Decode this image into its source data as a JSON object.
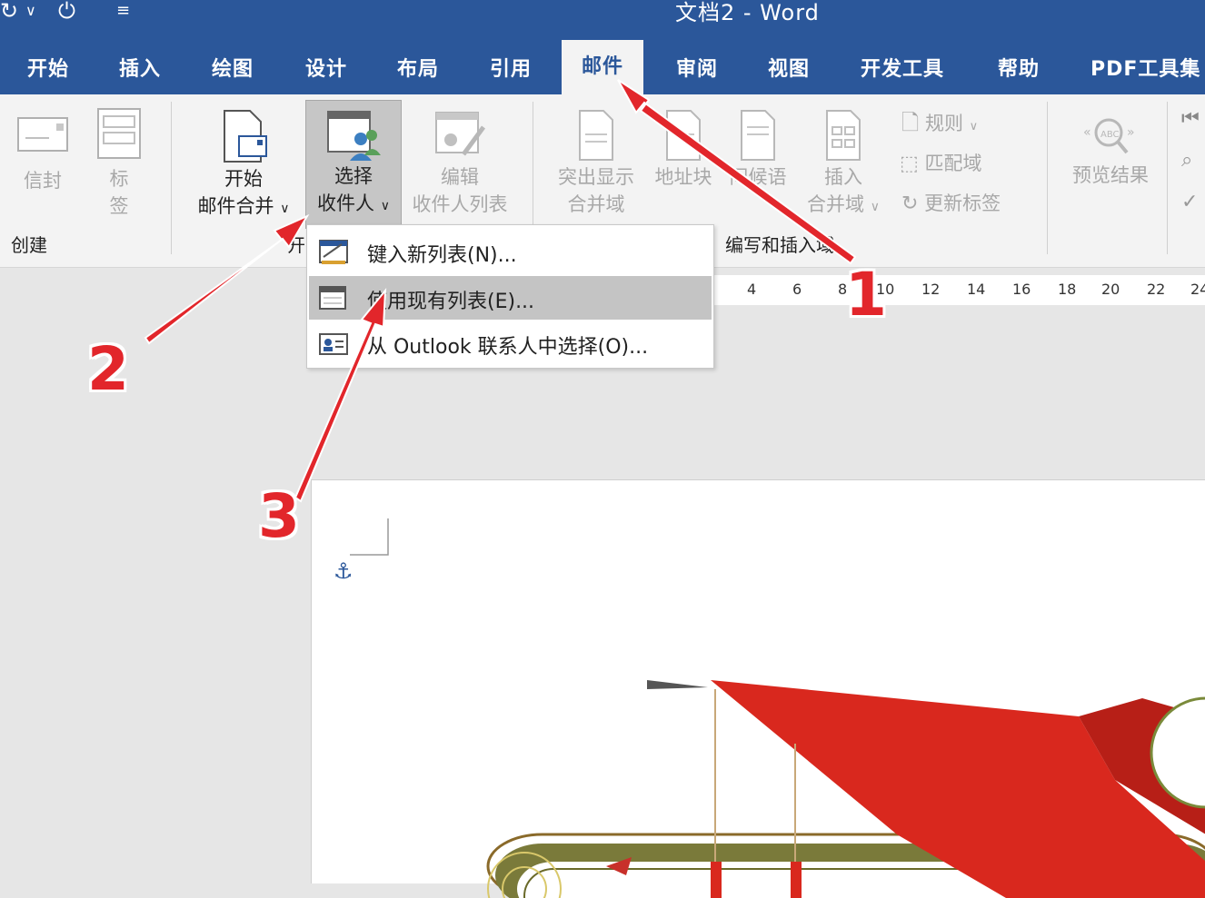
{
  "title": "文档2  -  Word",
  "tabs": [
    "开始",
    "插入",
    "绘图",
    "设计",
    "布局",
    "引用",
    "邮件",
    "审阅",
    "视图",
    "开发工具",
    "帮助",
    "PDF工具集"
  ],
  "active_tab": "邮件",
  "ribbon": {
    "create": {
      "envelope": "信封",
      "labels_1": "标",
      "labels_2": "签",
      "group": "创建"
    },
    "start": {
      "merge_1": "开始",
      "merge_2": "邮件合并",
      "select_1": "选择",
      "select_2": "收件人",
      "edit_1": "编辑",
      "edit_2": "收件人列表",
      "group": "开"
    },
    "fields": {
      "highlight_1": "突出显示",
      "highlight_2": "合并域",
      "address": "地址块",
      "greeting": "问候语",
      "insert_1": "插入",
      "insert_2": "合并域",
      "rules": "规则",
      "match": "匹配域",
      "update": "更新标签",
      "group": "编写和插入域"
    },
    "preview": {
      "label": "预览结果"
    }
  },
  "menu": {
    "items": [
      "键入新列表(N)...",
      "使用现有列表(E)...",
      "从 Outlook 联系人中选择(O)..."
    ]
  },
  "ruler": [
    "4",
    "6",
    "8",
    "10",
    "12",
    "14",
    "16",
    "18",
    "20",
    "22",
    "24"
  ],
  "steps": [
    "1",
    "2",
    "3"
  ],
  "colors": {
    "accent": "#2b579a",
    "annotation": "#e2262b"
  }
}
